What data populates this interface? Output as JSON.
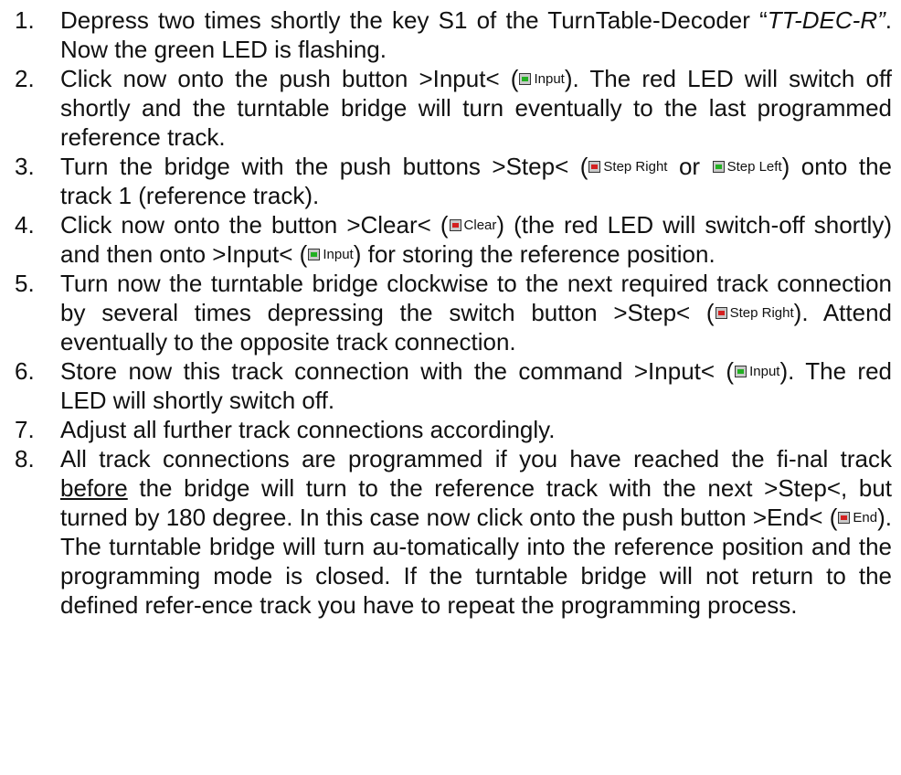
{
  "steps": [
    {
      "num": "1.",
      "t1": "Depress two times shortly the key S1 of the TurnTable-Decoder “",
      "em": "TT-DEC-R”",
      "t2": ". Now the green LED is flashing."
    },
    {
      "num": "2.",
      "t1": "Click now onto the push button >Input< (",
      "btn1": "Input",
      "t2": "). The red LED will switch off shortly and the turntable bridge will turn eventually to the last programmed reference track."
    },
    {
      "num": "3.",
      "t1": "Turn the bridge with the push buttons >Step< (",
      "btn1": "Step Right",
      "t2": " or ",
      "btn2": "Step Left",
      "t3": ") onto the track 1 (reference track)."
    },
    {
      "num": "4.",
      "t1": "Click now onto the button >Clear< (",
      "btn1": "Clear",
      "t2": ") (the red LED will switch-off shortly) and then onto >Input< (",
      "btn2": "Input",
      "t3": ") for storing the reference position."
    },
    {
      "num": "5.",
      "t1": "Turn now the turntable bridge clockwise to the next required track connection by several times depressing the switch button >Step< (",
      "btn1": "Step Right",
      "t2": "). Attend eventually to the opposite track connection."
    },
    {
      "num": "6.",
      "t1": "Store now this track connection with the command >Input< (",
      "btn1": "Input",
      "t2": "). The red LED will shortly switch off."
    },
    {
      "num": "7.",
      "t1": "Adjust all further track connections accordingly."
    },
    {
      "num": "8.",
      "t1": "All track connections are programmed if you have reached the fi-nal track ",
      "u": "before",
      "t2": " the bridge will turn to the reference track with the next >Step<, but turned by 180 degree. In this case now click onto the push button >End< (",
      "btn1": "End",
      "t3": "). The turntable bridge will turn au-tomatically into the reference position and the programming mode is closed. If the turntable bridge will not return to the defined refer-ence track you have to repeat the programming process."
    }
  ],
  "colors": {
    "led_green": "#22b022",
    "led_red": "#d42020"
  },
  "icons": {
    "green": "green-led-icon",
    "red": "red-led-icon"
  }
}
